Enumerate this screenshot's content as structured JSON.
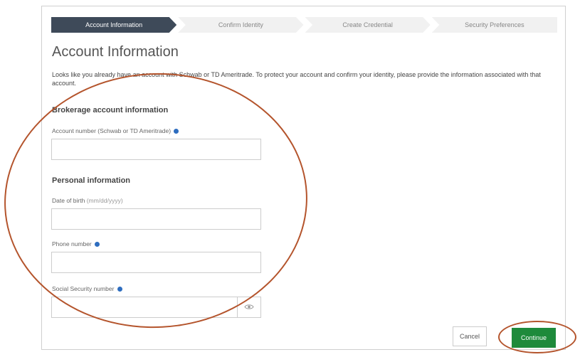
{
  "stepper": {
    "steps": [
      "Account Information",
      "Confirm Identity",
      "Create Credential",
      "Security Preferences"
    ],
    "active_index": 0,
    "active_color": "#3e4a59"
  },
  "page": {
    "title": "Account Information",
    "intro": "Looks like you already have an account with Schwab or TD Ameritrade. To protect your account and confirm your identity, please provide the information associated with that account."
  },
  "brokerage": {
    "title": "Brokerage account information",
    "account_label": "Account number (Schwab or TD Ameritrade)",
    "account_value": ""
  },
  "personal": {
    "title": "Personal information",
    "dob_label": "Date of birth",
    "dob_hint": "(mm/dd/yyyy)",
    "dob_value": "",
    "phone_label": "Phone number",
    "phone_value": "",
    "ssn_label": "Social Security number",
    "ssn_value": ""
  },
  "actions": {
    "cancel_label": "Cancel",
    "continue_label": "Continue",
    "continue_color": "#1e8a3b"
  },
  "annotation_color": "#b4542c"
}
